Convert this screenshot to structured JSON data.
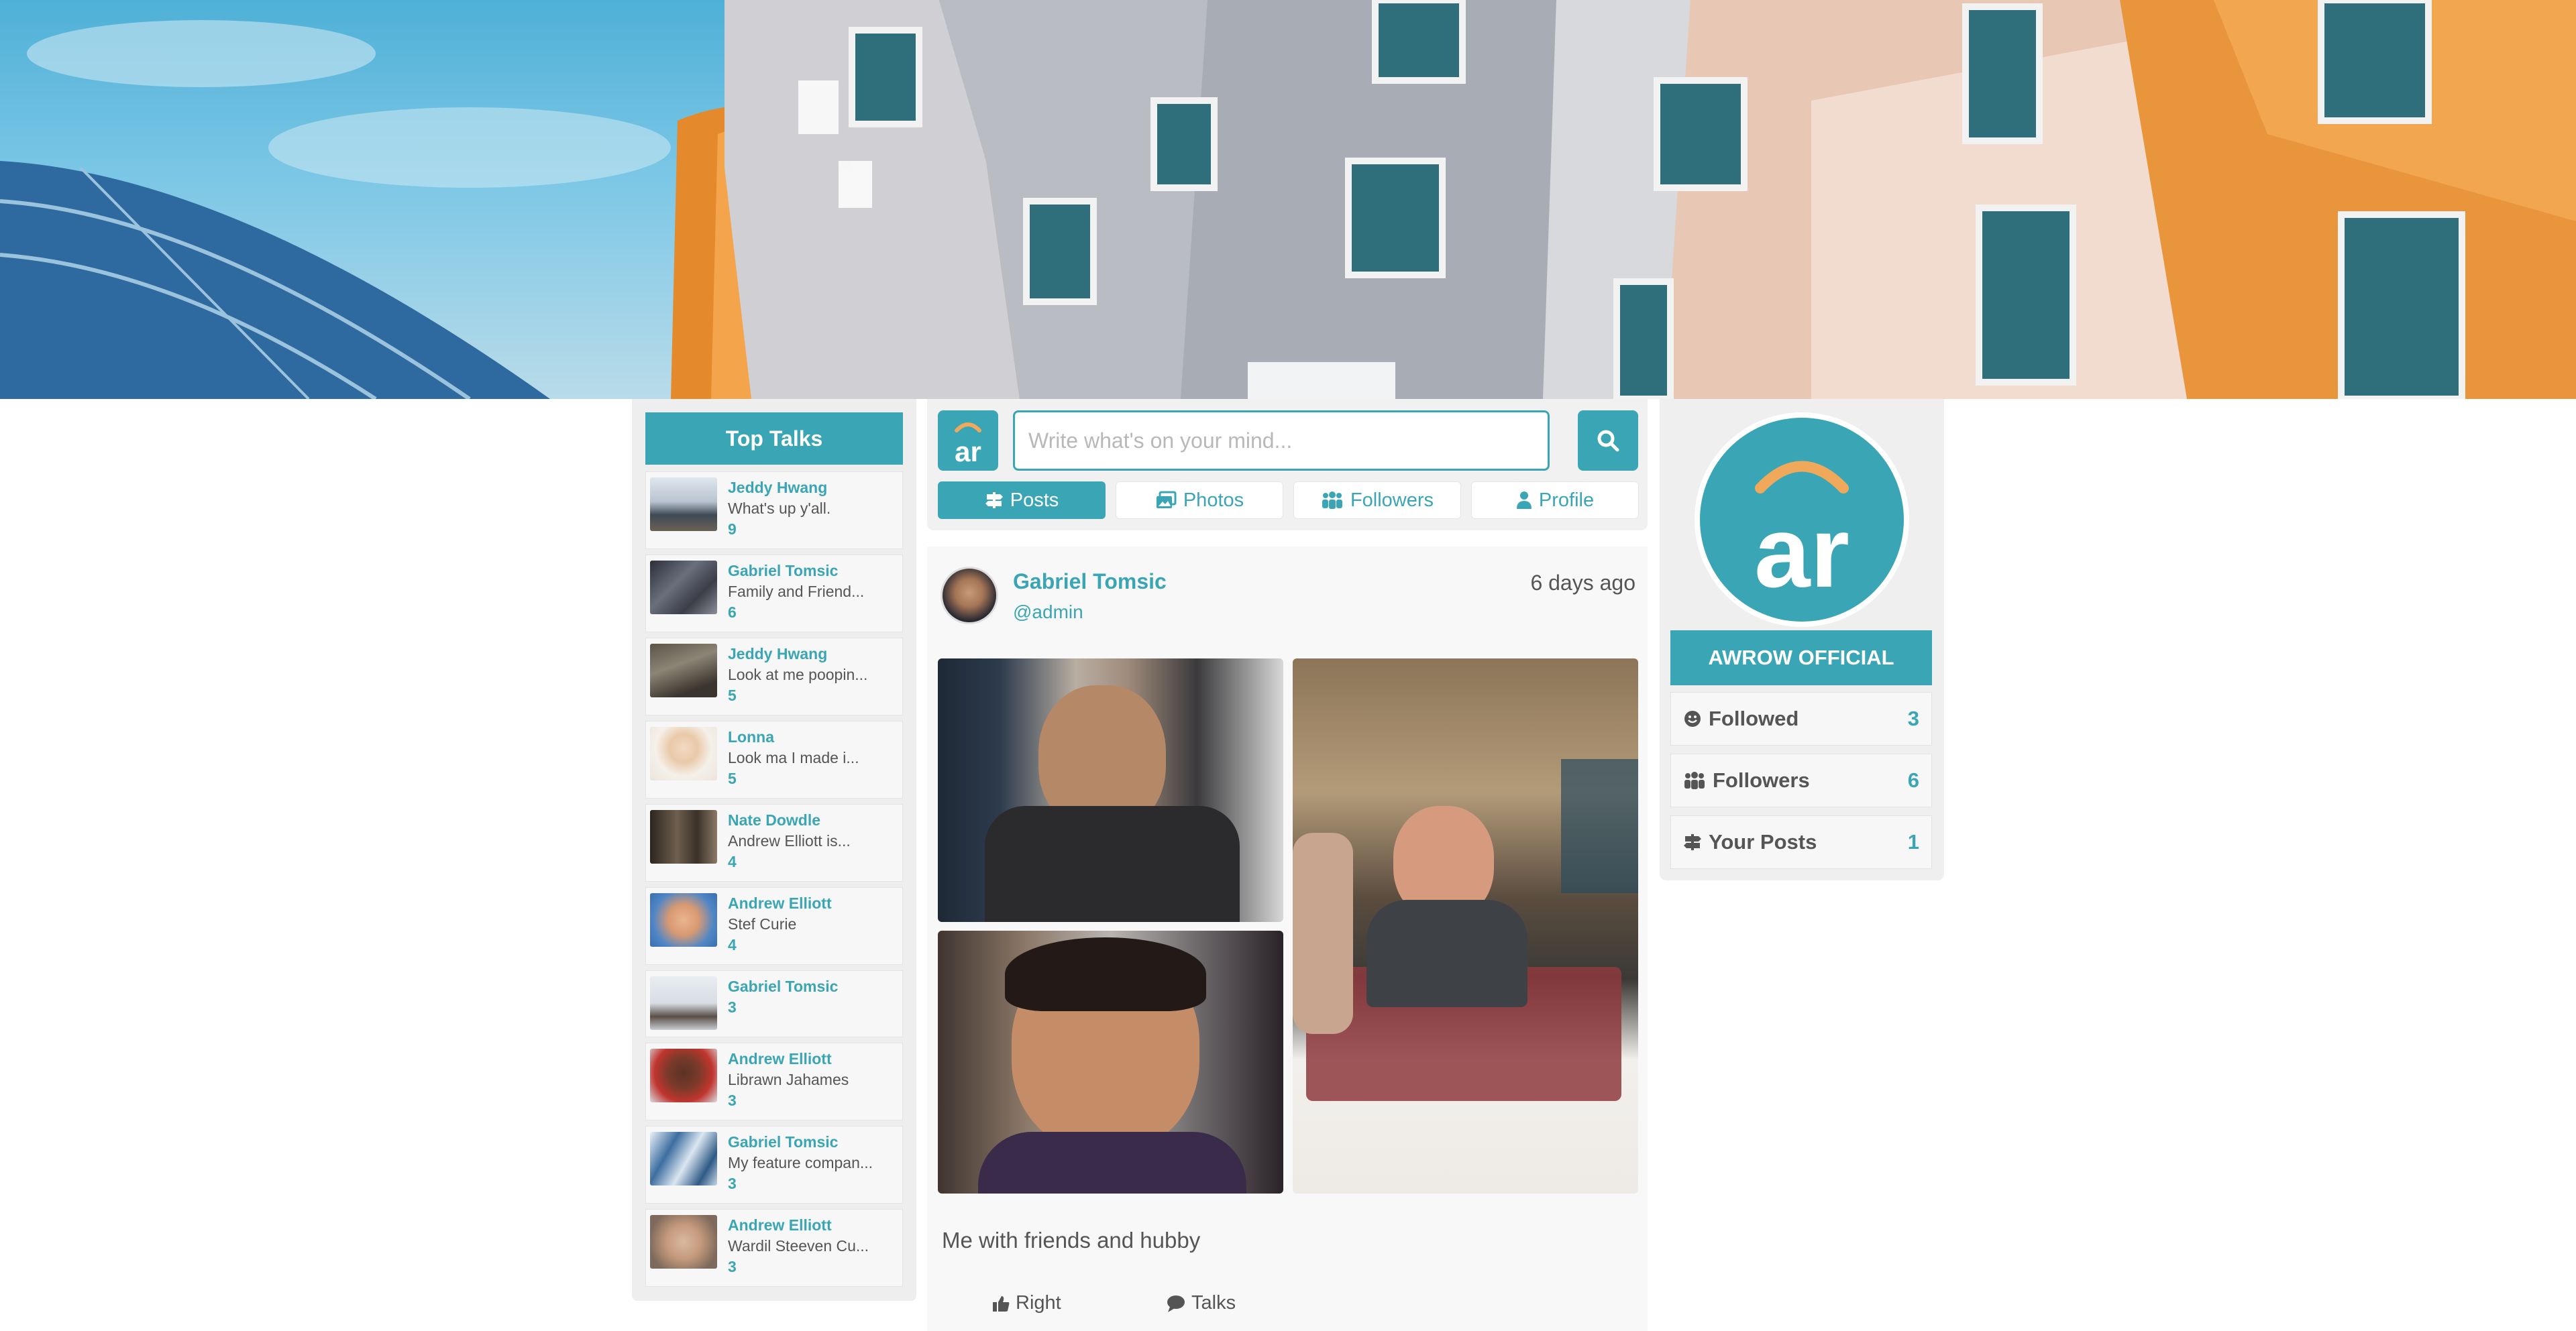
{
  "top_talks": {
    "title": "Top Talks",
    "items": [
      {
        "name": "Jeddy Hwang",
        "message": "What's up y'all.",
        "count": "9"
      },
      {
        "name": "Gabriel Tomsic",
        "message": "Family and Friend...",
        "count": "6"
      },
      {
        "name": "Jeddy Hwang",
        "message": "Look at me poopin...",
        "count": "5"
      },
      {
        "name": "Lonna",
        "message": "Look ma I made i...",
        "count": "5"
      },
      {
        "name": "Nate Dowdle",
        "message": "Andrew Elliott is...",
        "count": "4"
      },
      {
        "name": "Andrew Elliott",
        "message": "Stef Curie",
        "count": "4"
      },
      {
        "name": "Gabriel Tomsic",
        "message": "",
        "count": "3"
      },
      {
        "name": "Andrew Elliott",
        "message": "Librawn Jahames",
        "count": "3"
      },
      {
        "name": "Gabriel Tomsic",
        "message": "My feature compan...",
        "count": "3"
      },
      {
        "name": "Andrew Elliott",
        "message": "Wardil Steeven Cu...",
        "count": "3"
      }
    ]
  },
  "composer": {
    "logo_text": "ar",
    "placeholder": "Write what's on your mind...",
    "tabs": [
      {
        "label": "Posts",
        "icon": "signpost-icon"
      },
      {
        "label": "Photos",
        "icon": "photos-icon"
      },
      {
        "label": "Followers",
        "icon": "group-icon"
      },
      {
        "label": "Profile",
        "icon": "user-icon"
      }
    ]
  },
  "post": {
    "author": "Gabriel Tomsic",
    "handle": "@admin",
    "time": "6 days ago",
    "caption": "Me with friends and hubby",
    "actions": [
      {
        "label": "Right",
        "icon": "thumbs-up-icon"
      },
      {
        "label": "Talks",
        "icon": "speech-bubble-icon"
      }
    ]
  },
  "profile": {
    "avatar_text": "ar",
    "name": "AWROW OFFICIAL",
    "stats": [
      {
        "label": "Followed",
        "value": "3",
        "icon": "smile-icon"
      },
      {
        "label": "Followers",
        "value": "6",
        "icon": "group-icon"
      },
      {
        "label": "Your Posts",
        "value": "1",
        "icon": "signpost-icon"
      }
    ]
  },
  "colors": {
    "accent": "#3aa6b5",
    "logo_arc": "#f0a95a"
  }
}
